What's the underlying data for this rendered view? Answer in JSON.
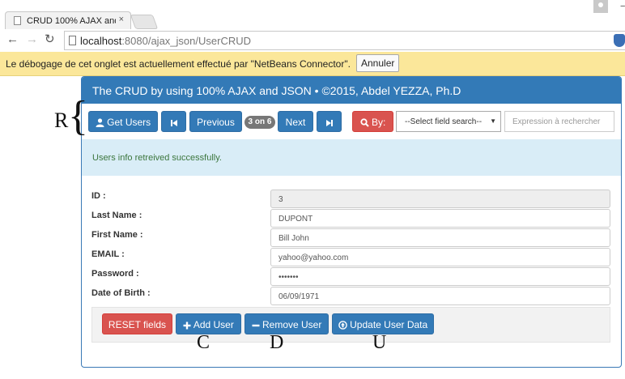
{
  "browser": {
    "tab_title": "CRUD 100% AJAX and JSO",
    "tab_close": "×",
    "url_host": "localhost",
    "url_rest": ":8080/ajax_json/UserCRUD",
    "infobar_message": "Le débogage de cet onglet est actuellement effectué par \"NetBeans Connector\".",
    "infobar_cancel": "Annuler"
  },
  "page": {
    "title": "The CRUD by using 100% AJAX and JSON • ©2015, Abdel YEZZA, Ph.D",
    "toolbar": {
      "get_users": "Get Users",
      "previous": "Previous",
      "position_badge": "3 on 6",
      "next": "Next",
      "search_by": "By:",
      "select_field": "--Select field search--",
      "search_placeholder": "Expression à rechercher"
    },
    "status_message": "Users info retreived successfully.",
    "form": {
      "fields": [
        {
          "label": "ID :",
          "value": "3",
          "readonly": true
        },
        {
          "label": "Last Name :",
          "value": "DUPONT"
        },
        {
          "label": "First Name :",
          "value": "Bill John"
        },
        {
          "label": "EMAIL :",
          "value": "yahoo@yahoo.com"
        },
        {
          "label": "Password :",
          "value": "•••••••"
        },
        {
          "label": "Date of Birth :",
          "value": "06/09/1971"
        }
      ]
    },
    "actions": {
      "reset": "RESET fields",
      "add": "Add User",
      "remove": "Remove User",
      "update": "Update User Data"
    }
  },
  "annotations": {
    "r": "R",
    "brace": "{",
    "c": "C",
    "d": "D",
    "u": "U"
  },
  "colors": {
    "primary": "#337ab7",
    "danger": "#d9534f",
    "info_bg": "#d9edf7",
    "success_text": "#3c763d",
    "infobar_bg": "#fbe79a"
  }
}
